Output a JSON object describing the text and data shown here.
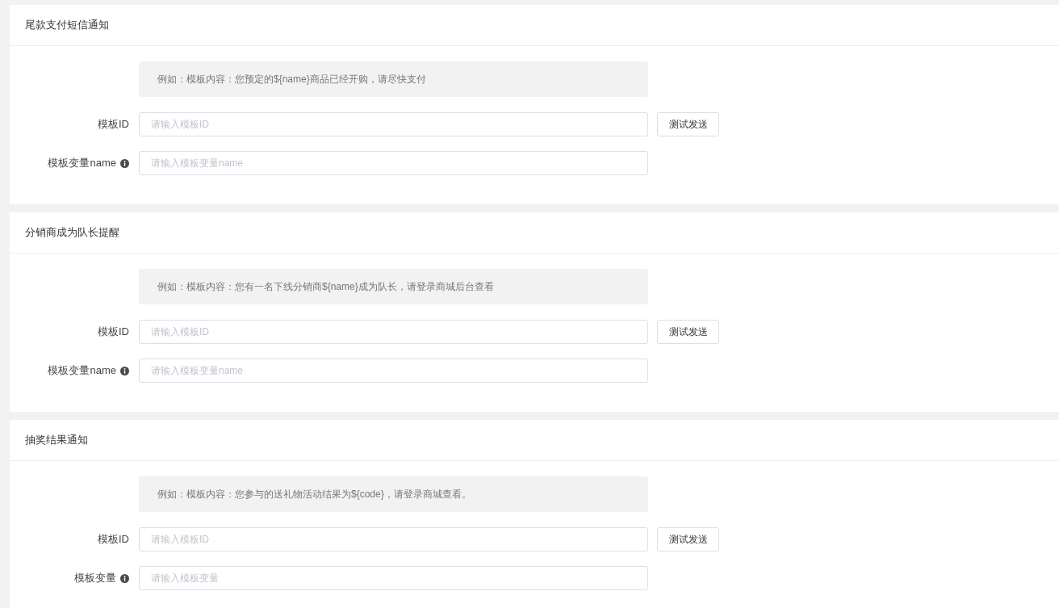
{
  "sections": [
    {
      "title": "尾款支付短信通知",
      "hint": "例如：模板内容：您预定的${name}商品已经开购，请尽快支付",
      "fields": [
        {
          "label": "模板ID",
          "placeholder": "请输入模板ID",
          "info": false,
          "button": "测试发送"
        },
        {
          "label": "模板变量name",
          "placeholder": "请输入模板变量name",
          "info": true
        }
      ]
    },
    {
      "title": "分销商成为队长提醒",
      "hint": "例如：模板内容：您有一名下线分销商${name}成为队长，请登录商城后台查看",
      "fields": [
        {
          "label": "模板ID",
          "placeholder": "请输入模板ID",
          "info": false,
          "button": "测试发送"
        },
        {
          "label": "模板变量name",
          "placeholder": "请输入模板变量name",
          "info": true
        }
      ]
    },
    {
      "title": "抽奖结果通知",
      "hint": "例如：模板内容：您参与的送礼物活动结果为${code}，请登录商城查看。",
      "fields": [
        {
          "label": "模板ID",
          "placeholder": "请输入模板ID",
          "info": false,
          "button": "测试发送"
        },
        {
          "label": "模板变量",
          "placeholder": "请输入模板变量",
          "info": true
        }
      ]
    }
  ]
}
